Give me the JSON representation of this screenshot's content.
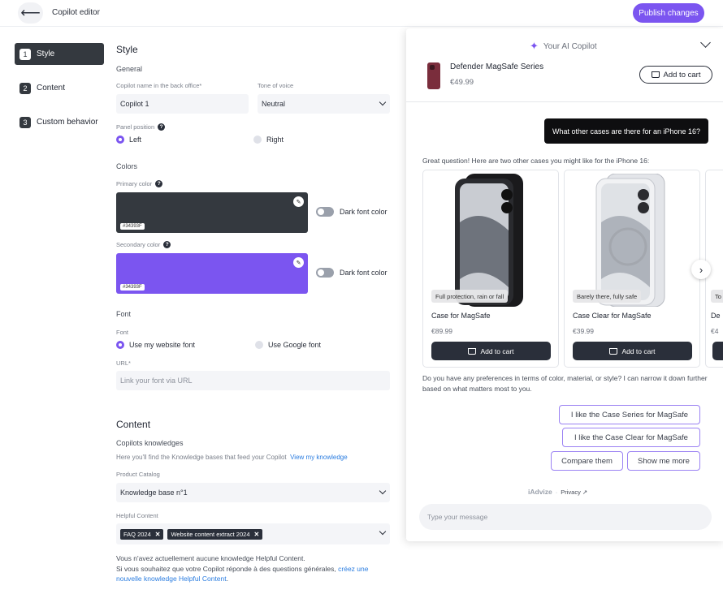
{
  "topbar": {
    "back_icon": "arrow-left-icon",
    "title": "Copilot editor",
    "publish_label": "Publish changes"
  },
  "steps": [
    {
      "num": "1",
      "label": "Style",
      "active": true
    },
    {
      "num": "2",
      "label": "Content",
      "active": false
    },
    {
      "num": "3",
      "label": "Custom behavior",
      "active": false
    }
  ],
  "style": {
    "title": "Style",
    "general": "General",
    "name_label": "Copilot name in the back office*",
    "name_value": "Copilot 1",
    "tone_label": "Tone of voice",
    "tone_value": "Neutral",
    "position_label": "Panel position",
    "position_left": "Left",
    "position_right": "Right",
    "position_selected": "Left",
    "colors": "Colors",
    "primary_label": "Primary color",
    "primary_hex": "#34393F",
    "secondary_label": "Secondary color",
    "secondary_hex": "#34393F",
    "secondary_color": "#7b55f0",
    "dark_font": "Dark font color",
    "font_title": "Font",
    "font_label": "Font",
    "font_website": "Use my website font",
    "font_google": "Use Google font",
    "font_selected": "Use my website font",
    "url_label": "URL*",
    "url_placeholder": "Link your font via URL"
  },
  "content": {
    "title": "Content",
    "knowledge": "Copilots knowledges",
    "knowledge_desc": "Here you'll find the Knowledge bases that feed your Copilot",
    "knowledge_link": "View my knowledge",
    "catalog_label": "Product Catalog",
    "catalog_value": "Knowledge base n°1",
    "helpful_label": "Helpful Content",
    "helpful_tags": [
      "FAQ 2024",
      "Website content extract 2024"
    ],
    "note_line1": "Vous n'avez actuellement aucune knowledge Helpful Content.",
    "note_line2": "Si vous souhaitez que votre Copilot réponde à des questions générales,",
    "note_link": "créez une nouvelle knowledge Helpful Content",
    "note_end": "."
  },
  "panel": {
    "title": "Your AI Copilot",
    "product_name": "Defender MagSafe Series",
    "product_price": "€49.99",
    "add_to_cart": "Add to cart",
    "user_message": "What other cases are there for an iPhone 16?",
    "bot_intro": "Great question! Here are two other cases you might like for the iPhone 16:",
    "cards": [
      {
        "badge": "Full protection, rain or fall",
        "name": "Case for MagSafe",
        "price": "€89.99",
        "cart": "Add to cart"
      },
      {
        "badge": "Barely there, fully safe",
        "name": "Case Clear for MagSafe",
        "price": "€39.99",
        "cart": "Add to cart"
      },
      {
        "badge": "To",
        "name": "De",
        "price": "€4",
        "cart": ""
      }
    ],
    "bot_followup": "Do you have any preferences in terms of color, material, or style? I can narrow it down further based on what matters most to you.",
    "chips": [
      "I like the Case Series for MagSafe",
      "I like the Case Clear for MagSafe",
      "Compare them",
      "Show me more"
    ],
    "brand": "iAdvize",
    "privacy": "Privacy ↗",
    "input_placeholder": "Type your message"
  }
}
